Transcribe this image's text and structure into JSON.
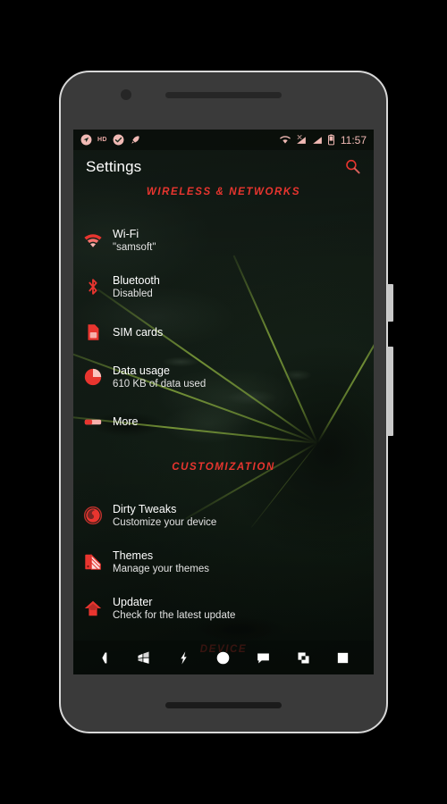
{
  "device": {
    "frame_color": "#3a3a3a",
    "frame_outline": "#d8d8d8",
    "buttons": [
      "power-button",
      "volume-button"
    ]
  },
  "theme": {
    "accent": "#e8352f",
    "accent_soft": "#f0b9b4",
    "text_primary": "#ffffff",
    "text_secondary": "#e3e3e3",
    "wallpaper": "dark-green-leaf-with-water-drops"
  },
  "statusbar": {
    "left_icons": [
      {
        "name": "location-arrow-icon",
        "label": "Location"
      },
      {
        "name": "hd-text-icon",
        "label": "HD"
      },
      {
        "name": "check-circle-icon",
        "label": "Verified"
      },
      {
        "name": "rocket-icon",
        "label": "Boost"
      }
    ],
    "right_icons": [
      {
        "name": "wifi-icon",
        "label": "Wi-Fi"
      },
      {
        "name": "signal-no-sim-icon",
        "label": "No SIM"
      },
      {
        "name": "signal-bars-icon",
        "label": "Signal"
      },
      {
        "name": "battery-icon",
        "label": "Battery"
      }
    ],
    "clock": "11:57"
  },
  "actionbar": {
    "title": "Settings",
    "search_icon": "search-icon"
  },
  "sections": [
    {
      "header": "WIRELESS & NETWORKS",
      "items": [
        {
          "icon": "wifi-icon",
          "title": "Wi-Fi",
          "subtitle": "\"samsoft\""
        },
        {
          "icon": "bluetooth-icon",
          "title": "Bluetooth",
          "subtitle": "Disabled"
        },
        {
          "icon": "sim-card-icon",
          "title": "SIM cards",
          "subtitle": ""
        },
        {
          "icon": "data-usage-pie-icon",
          "title": "Data usage",
          "subtitle": "610 KB of data used"
        },
        {
          "icon": "more-bar-icon",
          "title": "More",
          "subtitle": ""
        }
      ]
    },
    {
      "header": "CUSTOMIZATION",
      "items": [
        {
          "icon": "dirty-tweaks-icon",
          "title": "Dirty Tweaks",
          "subtitle": "Customize your device"
        },
        {
          "icon": "themes-swatch-icon",
          "title": "Themes",
          "subtitle": "Manage your themes"
        },
        {
          "icon": "updater-arrow-icon",
          "title": "Updater",
          "subtitle": "Check for the latest update"
        }
      ]
    },
    {
      "header": "DEVICE",
      "items": []
    }
  ],
  "navbar": {
    "buttons": [
      {
        "name": "back-button",
        "icon": "back-chevron-icon"
      },
      {
        "name": "windows-button",
        "icon": "windows-logo-icon"
      },
      {
        "name": "power-menu-button",
        "icon": "lightning-bolt-icon"
      },
      {
        "name": "home-button",
        "icon": "circle-home-icon"
      },
      {
        "name": "messages-button",
        "icon": "chat-bubble-icon"
      },
      {
        "name": "multiwindow-button",
        "icon": "overlapping-squares-icon"
      },
      {
        "name": "recents-button",
        "icon": "square-recents-icon"
      }
    ]
  }
}
